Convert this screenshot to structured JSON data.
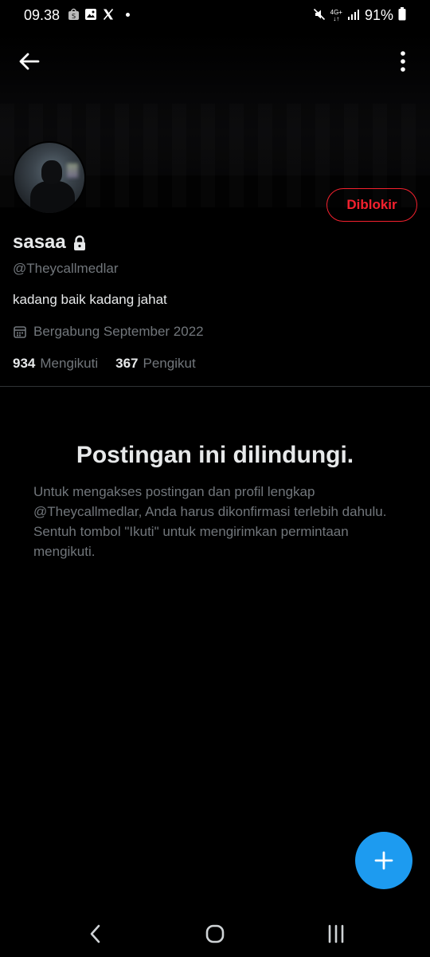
{
  "status_bar": {
    "time": "09.38",
    "left_icons": [
      "shopee-icon",
      "gallery-icon",
      "x-icon"
    ],
    "network_top": "4G+",
    "network_bottom": "↓↑",
    "battery": "91%"
  },
  "profile": {
    "display_name": "sasaa",
    "handle": "@Theycallmedlar",
    "bio": "kadang baik kadang jahat",
    "joined": "Bergabung September 2022",
    "following_count": "934",
    "following_label": "Mengikuti",
    "followers_count": "367",
    "followers_label": "Pengikut",
    "blocked_label": "Diblokir"
  },
  "protected": {
    "title": "Postingan ini dilindungi.",
    "description": "Untuk mengakses postingan dan profil lengkap @Theycallmedlar, Anda harus dikonfirmasi terlebih dahulu. Sentuh tombol \"Ikuti\" untuk mengirimkan permintaan mengikuti."
  },
  "colors": {
    "accent": "#1d9bf0",
    "blocked": "#f4212e",
    "secondary_text": "#71767b"
  }
}
